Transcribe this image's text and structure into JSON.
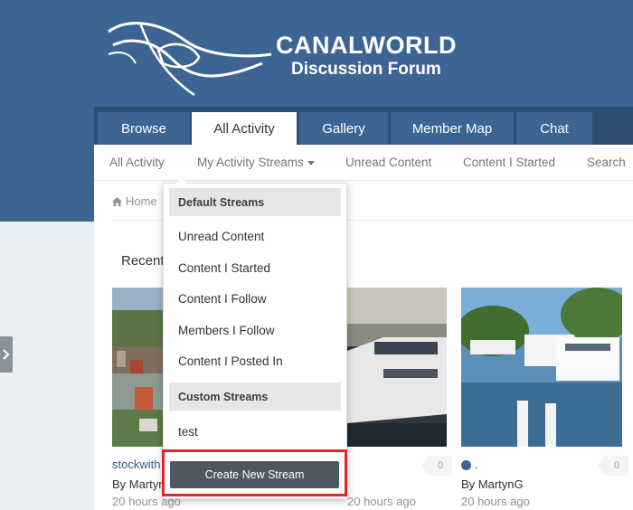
{
  "brand": {
    "title": "CANALWORLD",
    "subtitle": "Discussion Forum"
  },
  "tabs": [
    {
      "label": "Browse",
      "active": false
    },
    {
      "label": "All Activity",
      "active": true
    },
    {
      "label": "Gallery",
      "active": false
    },
    {
      "label": "Member Map",
      "active": false
    },
    {
      "label": "Chat",
      "active": false
    }
  ],
  "subnav": {
    "all_activity": "All Activity",
    "my_streams": "My Activity Streams",
    "unread": "Unread Content",
    "started": "Content I Started",
    "search": "Search"
  },
  "breadcrumb": {
    "home": "Home"
  },
  "section": {
    "title": "Recent"
  },
  "cards": [
    {
      "link": "stockwith",
      "author": "By Martyn",
      "time": "20 hours ago"
    },
    {
      "author": "",
      "time": "20 hours ago",
      "comments": "0"
    },
    {
      "link": ".",
      "author": "By MartynG",
      "time": "20 hours ago",
      "comments": "0"
    }
  ],
  "dropdown": {
    "default_header": "Default Streams",
    "default_items": [
      "Unread Content",
      "Content I Started",
      "Content I Follow",
      "Members I Follow",
      "Content I Posted In"
    ],
    "custom_header": "Custom Streams",
    "custom_items": [
      "test"
    ],
    "create_label": "Create New Stream"
  },
  "colors": {
    "header": "#3d6594",
    "tab_bar": "#2d4d72",
    "button": "#4d5863",
    "highlight": "#e3262c"
  }
}
